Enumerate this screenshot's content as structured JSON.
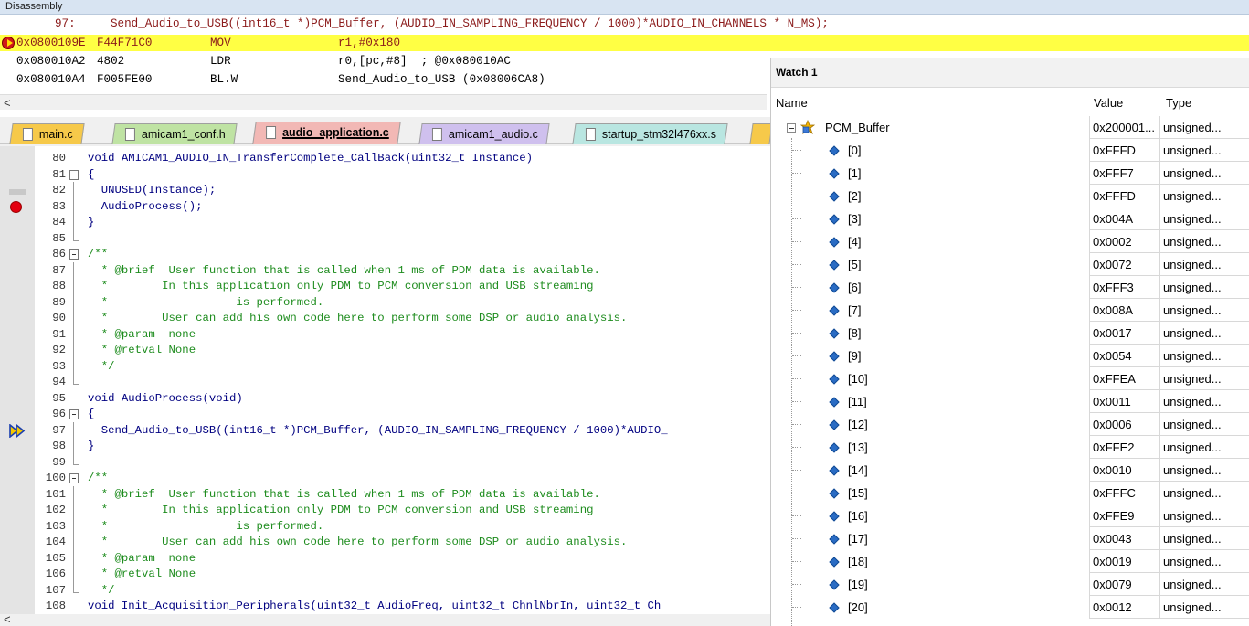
{
  "disassembly": {
    "title": "Disassembly",
    "source_line": {
      "num": "97:",
      "code": "Send_Audio_to_USB((int16_t *)PCM_Buffer, (AUDIO_IN_SAMPLING_FREQUENCY / 1000)*AUDIO_IN_CHANNELS * N_MS);"
    },
    "instructions": [
      {
        "addr": "0x0800109E",
        "opcode": "F44F71C0",
        "mnemonic": "MOV",
        "operands": "r1,#0x180"
      },
      {
        "addr": "0x080010A2",
        "opcode": "4802",
        "mnemonic": "LDR",
        "operands": "r0,[pc,#8]  ; @0x080010AC"
      },
      {
        "addr": "0x080010A4",
        "opcode": "F005FE00",
        "mnemonic": "BL.W",
        "operands": "Send_Audio_to_USB (0x08006CA8)"
      }
    ],
    "scroll_left_glyph": "<"
  },
  "tabs": [
    {
      "label": "main.c",
      "color": "#f6c94a"
    },
    {
      "label": "amicam1_conf.h",
      "color": "#bfe3a3"
    },
    {
      "label": "audio_application.c",
      "color": "#f2b8b5",
      "active": true
    },
    {
      "label": "amicam1_audio.c",
      "color": "#cfc0ee"
    },
    {
      "label": "startup_stm32l476xx.s",
      "color": "#b9e6e1"
    }
  ],
  "code_lines": [
    {
      "num": "80",
      "text": "void AMICAM1_AUDIO_IN_TransferComplete_CallBack(uint32_t Instance)"
    },
    {
      "num": "81",
      "text": "{"
    },
    {
      "num": "82",
      "text": "  UNUSED(Instance);"
    },
    {
      "num": "83",
      "text": "  AudioProcess();"
    },
    {
      "num": "84",
      "text": "}"
    },
    {
      "num": "85",
      "text": ""
    },
    {
      "num": "86",
      "text": "/**"
    },
    {
      "num": "87",
      "text": "  * @brief  User function that is called when 1 ms of PDM data is available."
    },
    {
      "num": "88",
      "text": "  *        In this application only PDM to PCM conversion and USB streaming"
    },
    {
      "num": "89",
      "text": "  *                   is performed."
    },
    {
      "num": "90",
      "text": "  *        User can add his own code here to perform some DSP or audio analysis."
    },
    {
      "num": "91",
      "text": "  * @param  none"
    },
    {
      "num": "92",
      "text": "  * @retval None"
    },
    {
      "num": "93",
      "text": "  */"
    },
    {
      "num": "94",
      "text": ""
    },
    {
      "num": "95",
      "text": "void AudioProcess(void)"
    },
    {
      "num": "96",
      "text": "{"
    },
    {
      "num": "97",
      "text": "  Send_Audio_to_USB((int16_t *)PCM_Buffer, (AUDIO_IN_SAMPLING_FREQUENCY / 1000)*AUDIO_"
    },
    {
      "num": "98",
      "text": "}"
    },
    {
      "num": "99",
      "text": ""
    },
    {
      "num": "100",
      "text": "/**"
    },
    {
      "num": "101",
      "text": "  * @brief  User function that is called when 1 ms of PDM data is available."
    },
    {
      "num": "102",
      "text": "  *        In this application only PDM to PCM conversion and USB streaming"
    },
    {
      "num": "103",
      "text": "  *                   is performed."
    },
    {
      "num": "104",
      "text": "  *        User can add his own code here to perform some DSP or audio analysis."
    },
    {
      "num": "105",
      "text": "  * @param  none"
    },
    {
      "num": "106",
      "text": "  * @retval None"
    },
    {
      "num": "107",
      "text": "  */"
    },
    {
      "num": "108",
      "text": "void Init_Acquisition_Peripherals(uint32_t AudioFreq, uint32_t ChnlNbrIn, uint32_t Ch"
    }
  ],
  "watch": {
    "title": "Watch 1",
    "columns": {
      "name": "Name",
      "value": "Value",
      "type": "Type"
    },
    "root": {
      "name": "PCM_Buffer",
      "value": "0x200001...",
      "type": "unsigned..."
    },
    "items": [
      {
        "name": "[0]",
        "value": "0xFFFD",
        "type": "unsigned..."
      },
      {
        "name": "[1]",
        "value": "0xFFF7",
        "type": "unsigned..."
      },
      {
        "name": "[2]",
        "value": "0xFFFD",
        "type": "unsigned..."
      },
      {
        "name": "[3]",
        "value": "0x004A",
        "type": "unsigned..."
      },
      {
        "name": "[4]",
        "value": "0x0002",
        "type": "unsigned..."
      },
      {
        "name": "[5]",
        "value": "0x0072",
        "type": "unsigned..."
      },
      {
        "name": "[6]",
        "value": "0xFFF3",
        "type": "unsigned..."
      },
      {
        "name": "[7]",
        "value": "0x008A",
        "type": "unsigned..."
      },
      {
        "name": "[8]",
        "value": "0x0017",
        "type": "unsigned..."
      },
      {
        "name": "[9]",
        "value": "0x0054",
        "type": "unsigned..."
      },
      {
        "name": "[10]",
        "value": "0xFFEA",
        "type": "unsigned..."
      },
      {
        "name": "[11]",
        "value": "0x0011",
        "type": "unsigned..."
      },
      {
        "name": "[12]",
        "value": "0x0006",
        "type": "unsigned..."
      },
      {
        "name": "[13]",
        "value": "0xFFE2",
        "type": "unsigned..."
      },
      {
        "name": "[14]",
        "value": "0x0010",
        "type": "unsigned..."
      },
      {
        "name": "[15]",
        "value": "0xFFFC",
        "type": "unsigned..."
      },
      {
        "name": "[16]",
        "value": "0xFFE9",
        "type": "unsigned..."
      },
      {
        "name": "[17]",
        "value": "0x0043",
        "type": "unsigned..."
      },
      {
        "name": "[18]",
        "value": "0x0019",
        "type": "unsigned..."
      },
      {
        "name": "[19]",
        "value": "0x0079",
        "type": "unsigned..."
      },
      {
        "name": "[20]",
        "value": "0x0012",
        "type": "unsigned..."
      }
    ]
  },
  "icons": {
    "current_instruction": "current-instruction-arrow-icon",
    "breakpoint": "breakpoint-icon",
    "program_counter": "program-counter-arrow-icon",
    "file": "file-icon",
    "watch_item": "watch-item-diamond-icon",
    "variable": "variable-icon",
    "collapse": "collapse-icon"
  },
  "colors": {
    "current_line_highlight": "#ffff44",
    "active_tab": "#f2b8b5",
    "breakpoint": "#e3000f",
    "comment": "#1e8c1e",
    "keyword": "#0000ff"
  }
}
